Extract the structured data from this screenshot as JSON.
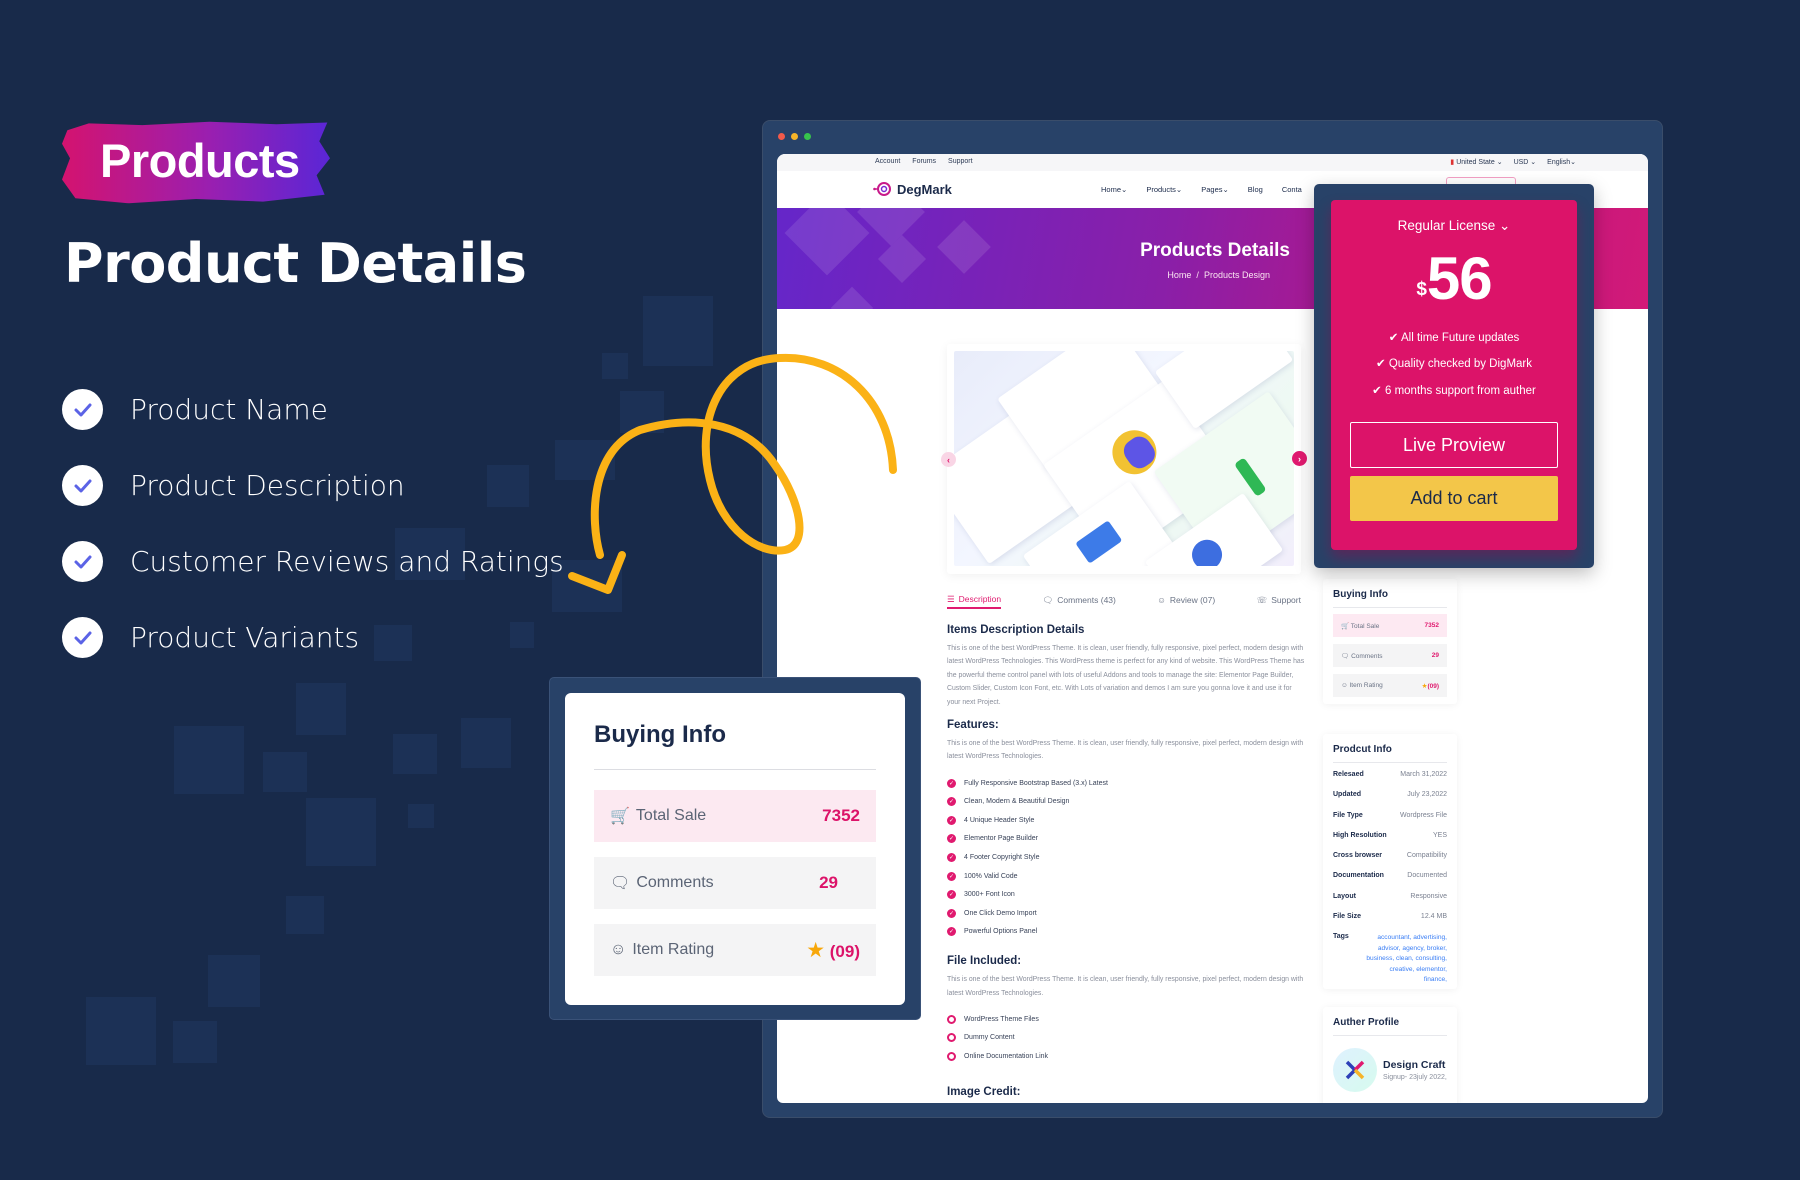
{
  "hero": {
    "badge": "Products",
    "title": "Product Details",
    "checklist": [
      {
        "label": "Product Name",
        "icon": "check-icon"
      },
      {
        "label": "Product Description",
        "icon": "check-icon"
      },
      {
        "label": "Customer Reviews and Ratings",
        "icon": "check-icon"
      },
      {
        "label": "Product Variants",
        "icon": "check-icon"
      }
    ]
  },
  "colors": {
    "background": "#182a4a",
    "accent_pink": "#dc1369",
    "accent_yellow": "#f3c649",
    "check_icon": "#5b63e6",
    "arrow": "#fbb216"
  },
  "browser": {
    "window_dots": [
      "#f25a4a",
      "#f6b428",
      "#37c44c"
    ],
    "topbar": {
      "links": [
        "Account",
        "Forums",
        "Support"
      ],
      "country": "United State",
      "currency": "USD",
      "language": "English"
    },
    "nav": {
      "logo": "DegMark",
      "menu": [
        "Home",
        "Products",
        "Pages",
        "Blog",
        "Conta"
      ]
    },
    "banner": {
      "title": "Products Details",
      "breadcrumb_home": "Home",
      "breadcrumb_sep": "/",
      "breadcrumb_current": "Products Design"
    },
    "tabs": [
      {
        "label": "Description",
        "icon": "layers-icon",
        "active": true
      },
      {
        "label": "Comments (43)",
        "icon": "chat-icon",
        "active": false
      },
      {
        "label": "Review (07)",
        "icon": "user-rating-icon",
        "active": false
      },
      {
        "label": "Support",
        "icon": "headset-icon",
        "active": false
      }
    ],
    "description": {
      "heading": "Items Description Details",
      "text": "This is one of the best WordPress Theme. It is clean, user friendly, fully responsive, pixel perfect, modern design with latest WordPress Technologies. This WordPress theme is perfect for any kind of website. This WordPress Theme has the powerful theme control panel with lots of useful Addons and tools to manage the site: Elementor Page Builder, Custom Slider, Custom Icon Font, etc. With Lots of variation and demos I am sure you gonna love it and use it for your next Project."
    },
    "features": {
      "heading": "Features:",
      "text": "This is one of the best WordPress Theme. It is clean, user friendly, fully responsive, pixel perfect, modern design with latest WordPress Technologies.",
      "items": [
        "Fully Responsive Bootstrap Based (3.x) Latest",
        "Clean, Modern & Beautiful Design",
        "4 Unique Header Style",
        "Elementor Page Builder",
        "4 Footer Copyright Style",
        "100% Valid Code",
        "3000+ Font Icon",
        "One Click Demo Import",
        "Powerful Options Panel"
      ]
    },
    "files": {
      "heading": "File Included:",
      "text": "This is one of the best WordPress Theme. It is clean, user friendly, fully responsive, pixel perfect, modern design with latest WordPress Technologies.",
      "items": [
        "WordPress Theme Files",
        "Dummy Content",
        "Online Documentation Link"
      ]
    },
    "image_credit_heading": "Image Credit:",
    "sidebar": {
      "buying_info": {
        "title": "Buying Info",
        "rows": [
          {
            "label": "Total Sale",
            "value": "7352",
            "icon": "cart-icon"
          },
          {
            "label": "Comments",
            "value": "29",
            "icon": "comment-icon"
          },
          {
            "label": "Item Rating",
            "value": "(09)",
            "icon": "rating-icon"
          }
        ]
      },
      "product_info": {
        "title": "Prodcut Info",
        "rows": [
          {
            "key": "Relesaed",
            "value": "March 31,2022"
          },
          {
            "key": "Updated",
            "value": "July 23,2022"
          },
          {
            "key": "File Type",
            "value": "Wordpress File"
          },
          {
            "key": "High Resolution",
            "value": "YES"
          },
          {
            "key": "Cross browser",
            "value": "Compatibility"
          },
          {
            "key": "Documentation",
            "value": "Documented"
          },
          {
            "key": "Layout",
            "value": "Responsive"
          },
          {
            "key": "File Size",
            "value": "12.4 MB"
          }
        ],
        "tags_label": "Tags",
        "tags": "accountant, advertising, advisor, agency, broker, business, clean, consulting, creative, elementor, finance,"
      },
      "author": {
        "title": "Auther Profile",
        "name": "Design Craft",
        "signup": "Signup- 23july 2022,"
      }
    }
  },
  "pricing": {
    "license": "Regular License",
    "currency": "$",
    "amount": "56",
    "perks": [
      "All time Future updates",
      "Quality checked by DigMark",
      "6 months support from auther"
    ],
    "live_preview": "Live Proview",
    "add_to_cart": "Add to cart"
  },
  "buying_popup": {
    "title": "Buying Info",
    "rows": [
      {
        "label": "Total Sale",
        "value": "7352",
        "icon": "cart-icon"
      },
      {
        "label": "Comments",
        "value": "29",
        "icon": "comment-icon"
      },
      {
        "label": "Item Rating",
        "value": "(09)",
        "icon": "rating-icon",
        "star": "★"
      }
    ]
  }
}
